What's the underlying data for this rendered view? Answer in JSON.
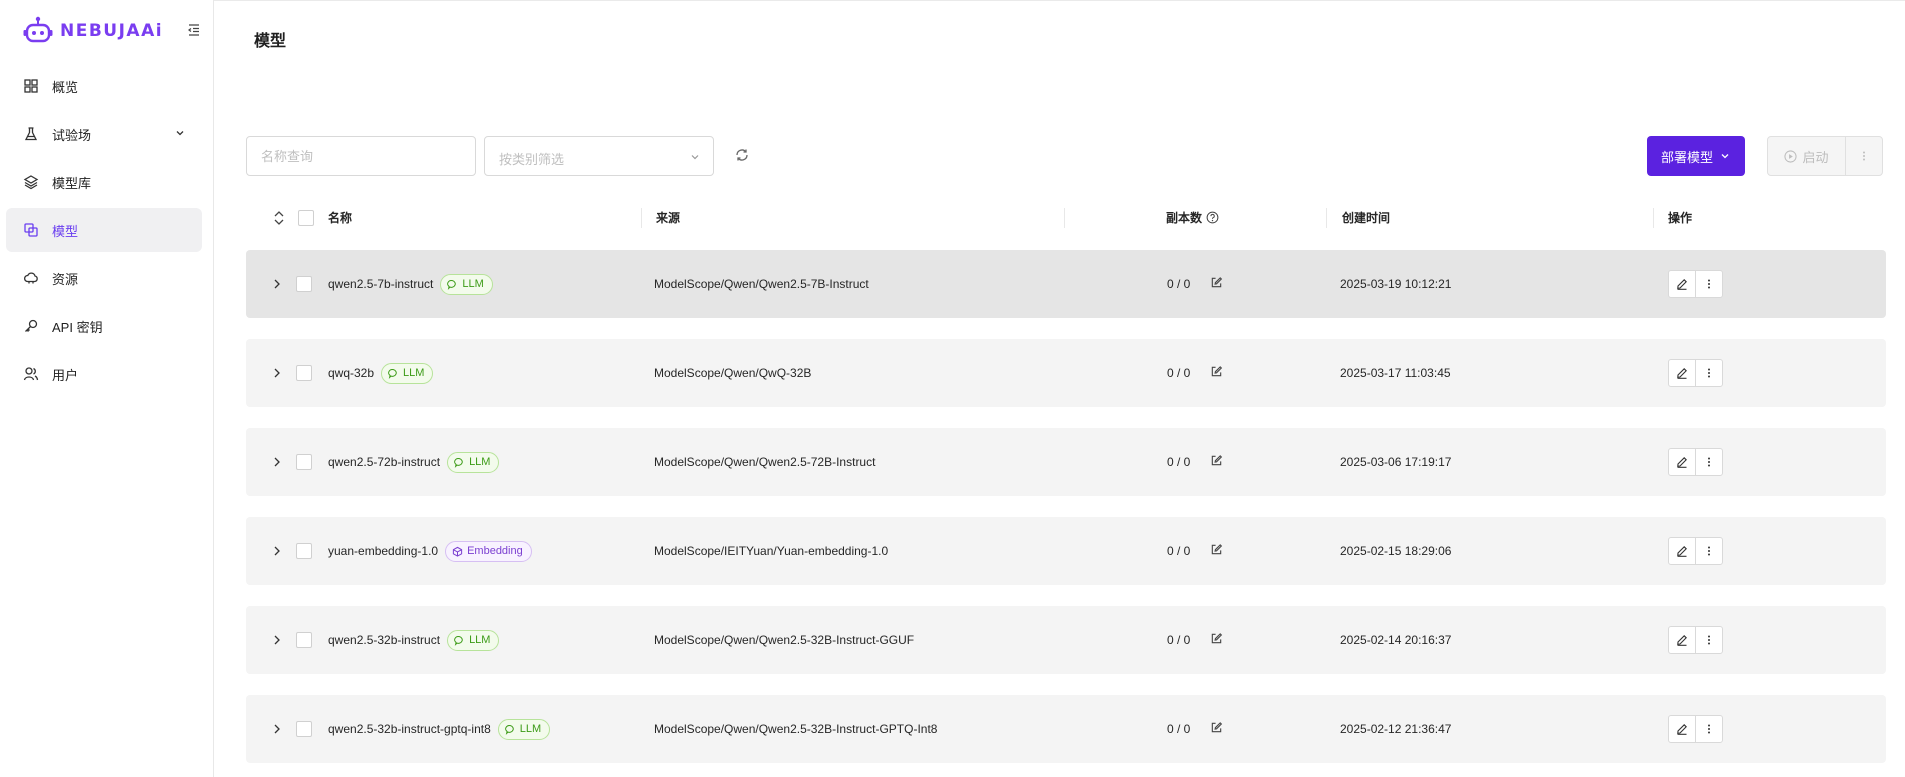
{
  "brand": {
    "name": "NEBUJAAi",
    "color": "#7a3df0"
  },
  "sidebar": {
    "items": [
      {
        "label": "概览",
        "icon": "dashboard-icon"
      },
      {
        "label": "试验场",
        "icon": "flask-icon",
        "expandable": true
      },
      {
        "label": "模型库",
        "icon": "layers-icon"
      },
      {
        "label": "模型",
        "icon": "models-icon",
        "active": true
      },
      {
        "label": "资源",
        "icon": "cloud-icon"
      },
      {
        "label": "API 密钥",
        "icon": "key-icon"
      },
      {
        "label": "用户",
        "icon": "users-icon"
      }
    ]
  },
  "main": {
    "title": "模型",
    "search": {
      "placeholder": "名称查询"
    },
    "category": {
      "placeholder": "按类别筛选"
    },
    "deploy_label": "部署模型",
    "start_label": "启动",
    "accent": "#5b22e0"
  },
  "table": {
    "columns": {
      "name": "名称",
      "source": "来源",
      "replicas": "副本数",
      "created": "创建时间",
      "actions": "操作"
    },
    "rows": [
      {
        "name": "qwen2.5-7b-instruct",
        "tag": "LLM",
        "tag_type": "llm",
        "source": "ModelScope/Qwen/Qwen2.5-7B-Instruct",
        "replicas": "0 / 0",
        "created": "2025-03-19 10:12:21",
        "selected": true
      },
      {
        "name": "qwq-32b",
        "tag": "LLM",
        "tag_type": "llm",
        "source": "ModelScope/Qwen/QwQ-32B",
        "replicas": "0 / 0",
        "created": "2025-03-17 11:03:45"
      },
      {
        "name": "qwen2.5-72b-instruct",
        "tag": "LLM",
        "tag_type": "llm",
        "source": "ModelScope/Qwen/Qwen2.5-72B-Instruct",
        "replicas": "0 / 0",
        "created": "2025-03-06 17:19:17"
      },
      {
        "name": "yuan-embedding-1.0",
        "tag": "Embedding",
        "tag_type": "emb",
        "source": "ModelScope/IEITYuan/Yuan-embedding-1.0",
        "replicas": "0 / 0",
        "created": "2025-02-15 18:29:06"
      },
      {
        "name": "qwen2.5-32b-instruct",
        "tag": "LLM",
        "tag_type": "llm",
        "source": "ModelScope/Qwen/Qwen2.5-32B-Instruct-GGUF",
        "replicas": "0 / 0",
        "created": "2025-02-14 20:16:37"
      },
      {
        "name": "qwen2.5-32b-instruct-gptq-int8",
        "tag": "LLM",
        "tag_type": "llm",
        "source": "ModelScope/Qwen/Qwen2.5-32B-Instruct-GPTQ-Int8",
        "replicas": "0 / 0",
        "created": "2025-02-12 21:36:47"
      }
    ]
  }
}
